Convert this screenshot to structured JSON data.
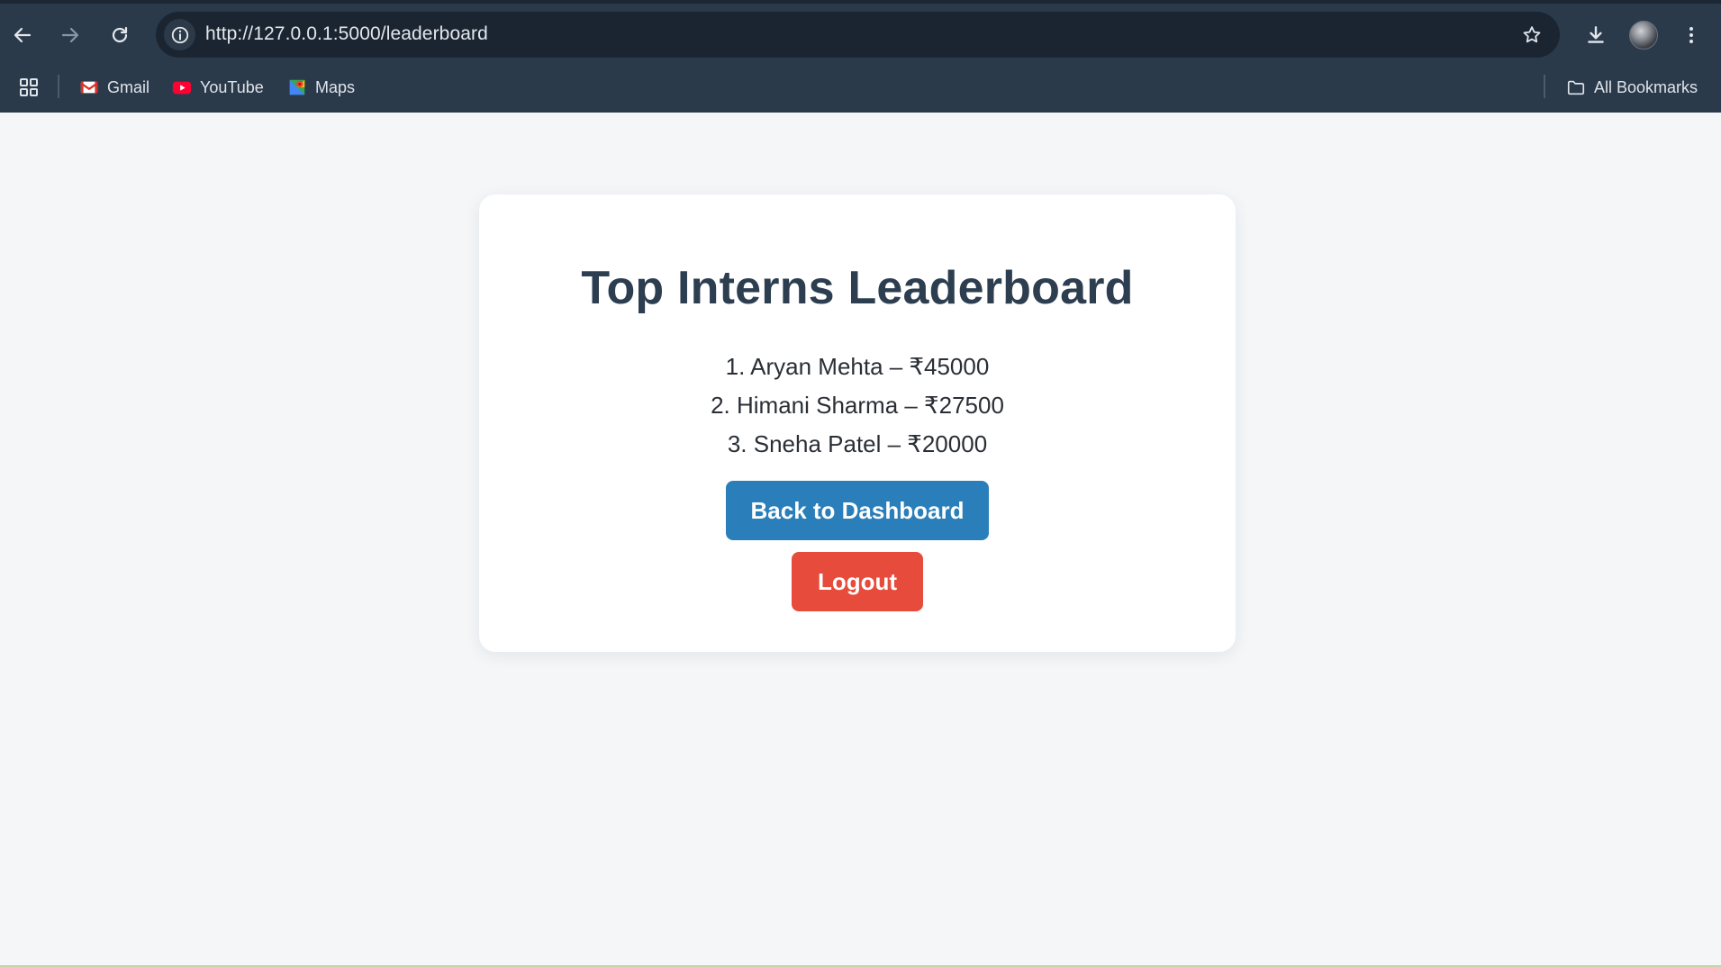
{
  "browser": {
    "url": "http://127.0.0.1:5000/leaderboard",
    "bookmarks": [
      {
        "label": "Gmail",
        "icon": "gmail-icon"
      },
      {
        "label": "YouTube",
        "icon": "youtube-icon"
      },
      {
        "label": "Maps",
        "icon": "maps-icon"
      }
    ],
    "all_bookmarks_label": "All Bookmarks"
  },
  "page": {
    "title": "Top Interns Leaderboard",
    "leaderboard": [
      "1. Aryan Mehta – ₹45000",
      "2. Himani Sharma – ₹27500",
      "3. Sneha Patel – ₹20000"
    ],
    "dashboard_button_label": "Back to Dashboard",
    "logout_button_label": "Logout"
  },
  "colors": {
    "browser_chrome": "#2b3a4b",
    "omnibox": "#1b2532",
    "page_background": "#f4f6f8",
    "title_text": "#2c3e50",
    "dashboard_button": "#2a7fba",
    "logout_button": "#e64b3c"
  }
}
